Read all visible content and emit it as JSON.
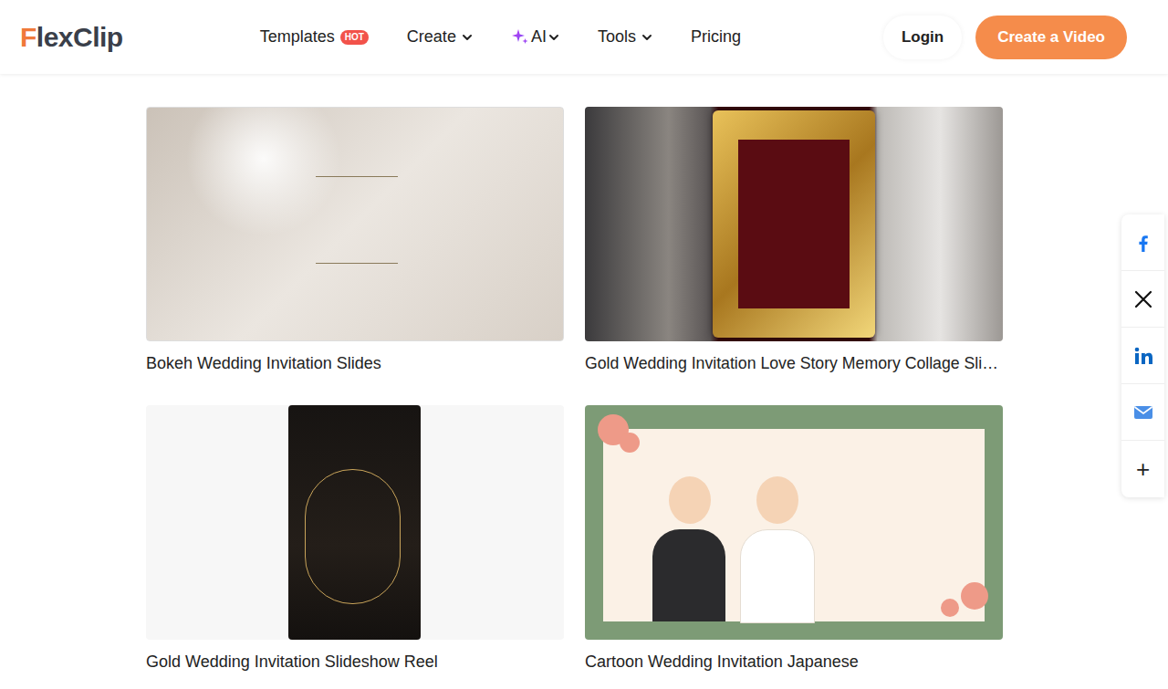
{
  "header": {
    "logo": "FlexClip",
    "nav": [
      {
        "label": "Templates",
        "badge": "HOT",
        "kind": "badge"
      },
      {
        "label": "Create",
        "kind": "dropdown"
      },
      {
        "label": "AI",
        "kind": "ai"
      },
      {
        "label": "Tools",
        "kind": "dropdown"
      },
      {
        "label": "Pricing",
        "kind": "plain"
      }
    ],
    "login": "Login",
    "cta": "Create a Video"
  },
  "templates": [
    {
      "title": "Bokeh Wedding Invitation Slides",
      "kind": "bokeh"
    },
    {
      "title": "Gold Wedding Invitation Love Story Memory Collage Sli…",
      "kind": "frame"
    },
    {
      "title": "Gold Wedding Invitation Slideshow Reel",
      "kind": "reel"
    },
    {
      "title": "Cartoon Wedding Invitation Japanese",
      "kind": "cartoon"
    }
  ],
  "share": [
    {
      "kind": "facebook"
    },
    {
      "kind": "x"
    },
    {
      "kind": "linkedin"
    },
    {
      "kind": "email"
    },
    {
      "kind": "more",
      "label": "+"
    }
  ]
}
